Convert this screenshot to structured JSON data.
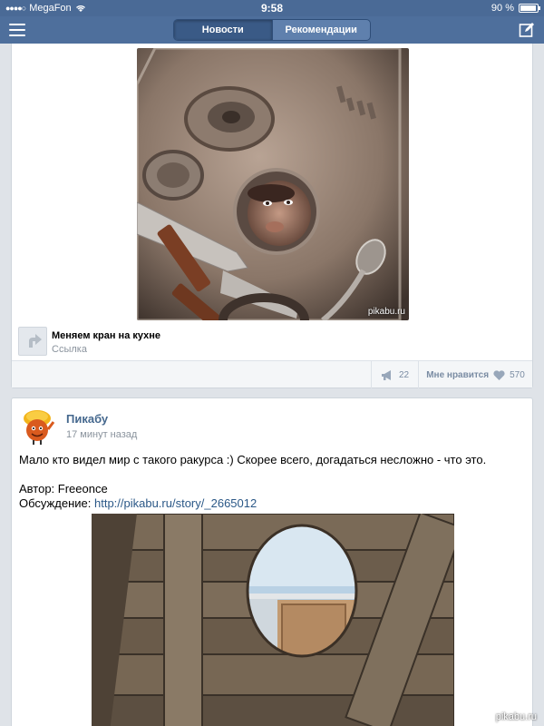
{
  "status_bar": {
    "carrier": "MegaFon",
    "time": "9:58",
    "battery": "90 %"
  },
  "nav": {
    "tabs": [
      "Новости",
      "Рекомендации"
    ],
    "active_tab": "Новости"
  },
  "post1": {
    "link_title": "Меняем кран на кухне",
    "link_type": "Ссылка",
    "shares": "22",
    "like_label": "Мне нравится",
    "likes": "570",
    "image_watermark": "pikabu.ru"
  },
  "post2": {
    "author": "Пикабу",
    "time": "17 минут назад",
    "text": "Мало кто видел мир с такого ракурса :) Скорее всего, догадаться несложно - что это.",
    "author_line": "Автор: Freeonce",
    "discussion_label": "Обсуждение:",
    "discussion_link": "http://pikabu.ru/story/_2665012"
  },
  "page_watermark": "pikabu.ru",
  "colors": {
    "navbar": "#4e6f9c",
    "link": "#2b5887",
    "author": "#45688e",
    "muted": "#8a939d"
  },
  "icons": {
    "menu": "hamburger-icon",
    "compose": "compose-icon",
    "share": "megaphone-icon",
    "like": "heart-icon",
    "link": "link-arrow-icon"
  }
}
